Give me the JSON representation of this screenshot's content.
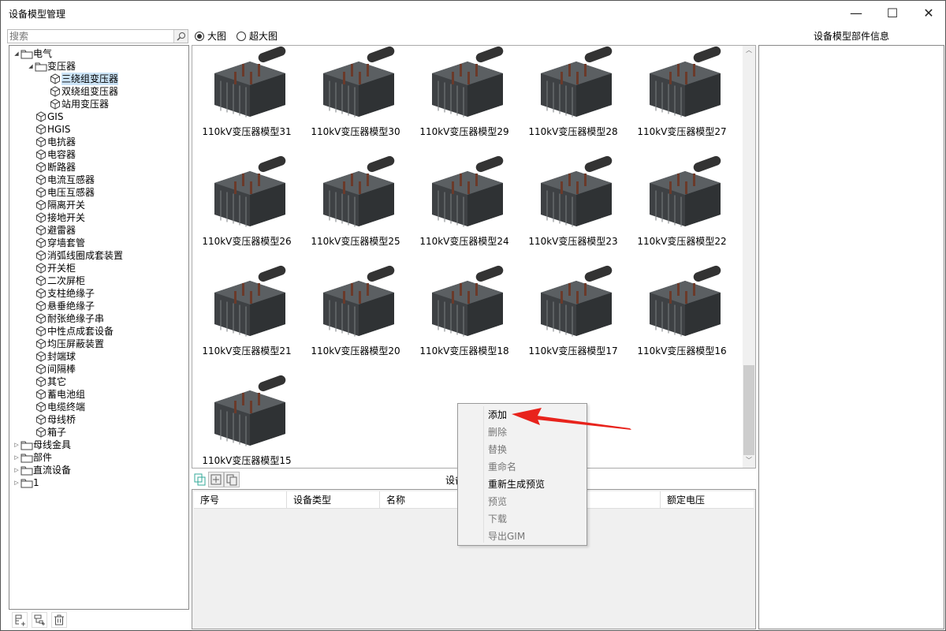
{
  "window": {
    "title": "设备模型管理",
    "minimize": "—",
    "maximize": "☐",
    "close": "✕"
  },
  "search": {
    "placeholder": "搜索"
  },
  "tree": [
    {
      "label": "电气",
      "level": 0,
      "icon": "folder",
      "exp": "open"
    },
    {
      "label": "变压器",
      "level": 1,
      "icon": "folder",
      "exp": "open"
    },
    {
      "label": "三绕组变压器",
      "level": 2,
      "icon": "cube",
      "selected": true
    },
    {
      "label": "双绕组变压器",
      "level": 2,
      "icon": "cube"
    },
    {
      "label": "站用变压器",
      "level": 2,
      "icon": "cube"
    },
    {
      "label": "GIS",
      "level": 1,
      "icon": "cube"
    },
    {
      "label": "HGIS",
      "level": 1,
      "icon": "cube"
    },
    {
      "label": "电抗器",
      "level": 1,
      "icon": "cube"
    },
    {
      "label": "电容器",
      "level": 1,
      "icon": "cube"
    },
    {
      "label": "断路器",
      "level": 1,
      "icon": "cube"
    },
    {
      "label": "电流互感器",
      "level": 1,
      "icon": "cube"
    },
    {
      "label": "电压互感器",
      "level": 1,
      "icon": "cube"
    },
    {
      "label": "隔离开关",
      "level": 1,
      "icon": "cube"
    },
    {
      "label": "接地开关",
      "level": 1,
      "icon": "cube"
    },
    {
      "label": "避雷器",
      "level": 1,
      "icon": "cube"
    },
    {
      "label": "穿墙套管",
      "level": 1,
      "icon": "cube"
    },
    {
      "label": "消弧线圈成套装置",
      "level": 1,
      "icon": "cube"
    },
    {
      "label": "开关柜",
      "level": 1,
      "icon": "cube"
    },
    {
      "label": "二次屏柜",
      "level": 1,
      "icon": "cube"
    },
    {
      "label": "支柱绝缘子",
      "level": 1,
      "icon": "cube"
    },
    {
      "label": "悬垂绝缘子",
      "level": 1,
      "icon": "cube"
    },
    {
      "label": "耐张绝缘子串",
      "level": 1,
      "icon": "cube"
    },
    {
      "label": "中性点成套设备",
      "level": 1,
      "icon": "cube"
    },
    {
      "label": "均压屏蔽装置",
      "level": 1,
      "icon": "cube"
    },
    {
      "label": "封端球",
      "level": 1,
      "icon": "cube"
    },
    {
      "label": "间隔棒",
      "level": 1,
      "icon": "cube"
    },
    {
      "label": "其它",
      "level": 1,
      "icon": "cube"
    },
    {
      "label": "蓄电池组",
      "level": 1,
      "icon": "cube"
    },
    {
      "label": "电缆终端",
      "level": 1,
      "icon": "cube"
    },
    {
      "label": "母线桥",
      "level": 1,
      "icon": "cube"
    },
    {
      "label": "箱子",
      "level": 1,
      "icon": "cube"
    },
    {
      "label": "母线金具",
      "level": 0,
      "icon": "folder",
      "exp": "closed"
    },
    {
      "label": "部件",
      "level": 0,
      "icon": "folder",
      "exp": "closed"
    },
    {
      "label": "直流设备",
      "level": 0,
      "icon": "folder",
      "exp": "closed"
    },
    {
      "label": "1",
      "level": 0,
      "icon": "folder",
      "exp": "closed"
    }
  ],
  "view_options": [
    {
      "label": "大图",
      "checked": true
    },
    {
      "label": "超大图",
      "checked": false
    }
  ],
  "models": [
    "110kV变压器模型31",
    "110kV变压器模型30",
    "110kV变压器模型29",
    "110kV变压器模型28",
    "110kV变压器模型27",
    "110kV变压器模型26",
    "110kV变压器模型25",
    "110kV变压器模型24",
    "110kV变压器模型23",
    "110kV变压器模型22",
    "110kV变压器模型21",
    "110kV变压器模型20",
    "110kV变压器模型18",
    "110kV变压器模型17",
    "110kV变压器模型16",
    "110kV变压器模型15"
  ],
  "bottom": {
    "title": "设备",
    "columns": [
      "序号",
      "设备类型",
      "名称",
      "",
      "生产厂家",
      "额定电压"
    ]
  },
  "right_panel": {
    "title": "设备模型部件信息"
  },
  "context_menu": [
    {
      "label": "添加",
      "enabled": true
    },
    {
      "label": "删除",
      "enabled": false
    },
    {
      "label": "替换",
      "enabled": false
    },
    {
      "label": "重命名",
      "enabled": false
    },
    {
      "label": "重新生成预览",
      "enabled": true
    },
    {
      "label": "预览",
      "enabled": false
    },
    {
      "label": "下载",
      "enabled": false
    },
    {
      "label": "导出GIM",
      "enabled": false
    }
  ],
  "colors": {
    "accent": "#cce4f7",
    "arrow": "#e8231c"
  }
}
